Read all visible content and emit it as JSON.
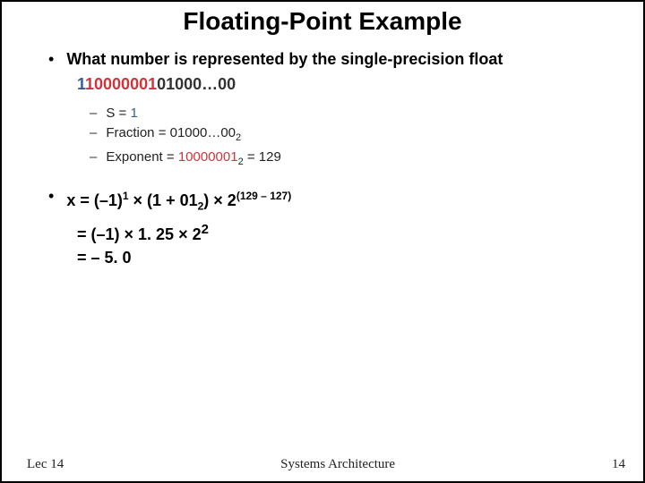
{
  "title": "Floating-Point Example",
  "q": "What number is represented by the single-precision float",
  "bits": {
    "s": "1",
    "e": "10000001",
    "f": "01000…00"
  },
  "sub": {
    "s_lbl": "S = ",
    "s_val": "1",
    "f_lbl": "Fraction = ",
    "f_val": "01000…00",
    "f_sub": "2",
    "e_lbl": "Exponent = ",
    "e_val": "10000001",
    "e_sub": "2",
    "e_eq": " = 129"
  },
  "calc": {
    "line1_a": "x = (–1)",
    "line1_sup1": "1",
    "line1_b": " × (1 + 01",
    "line1_sub": "2",
    "line1_c": ") × 2",
    "line1_sup2": "(129 – 127)",
    "line2": "= (–1) × 1. 25 × 2",
    "line2_sup": "2",
    "line3": "= – 5. 0"
  },
  "footer": {
    "left": "Lec 14",
    "center": "Systems Architecture",
    "right": "14"
  }
}
